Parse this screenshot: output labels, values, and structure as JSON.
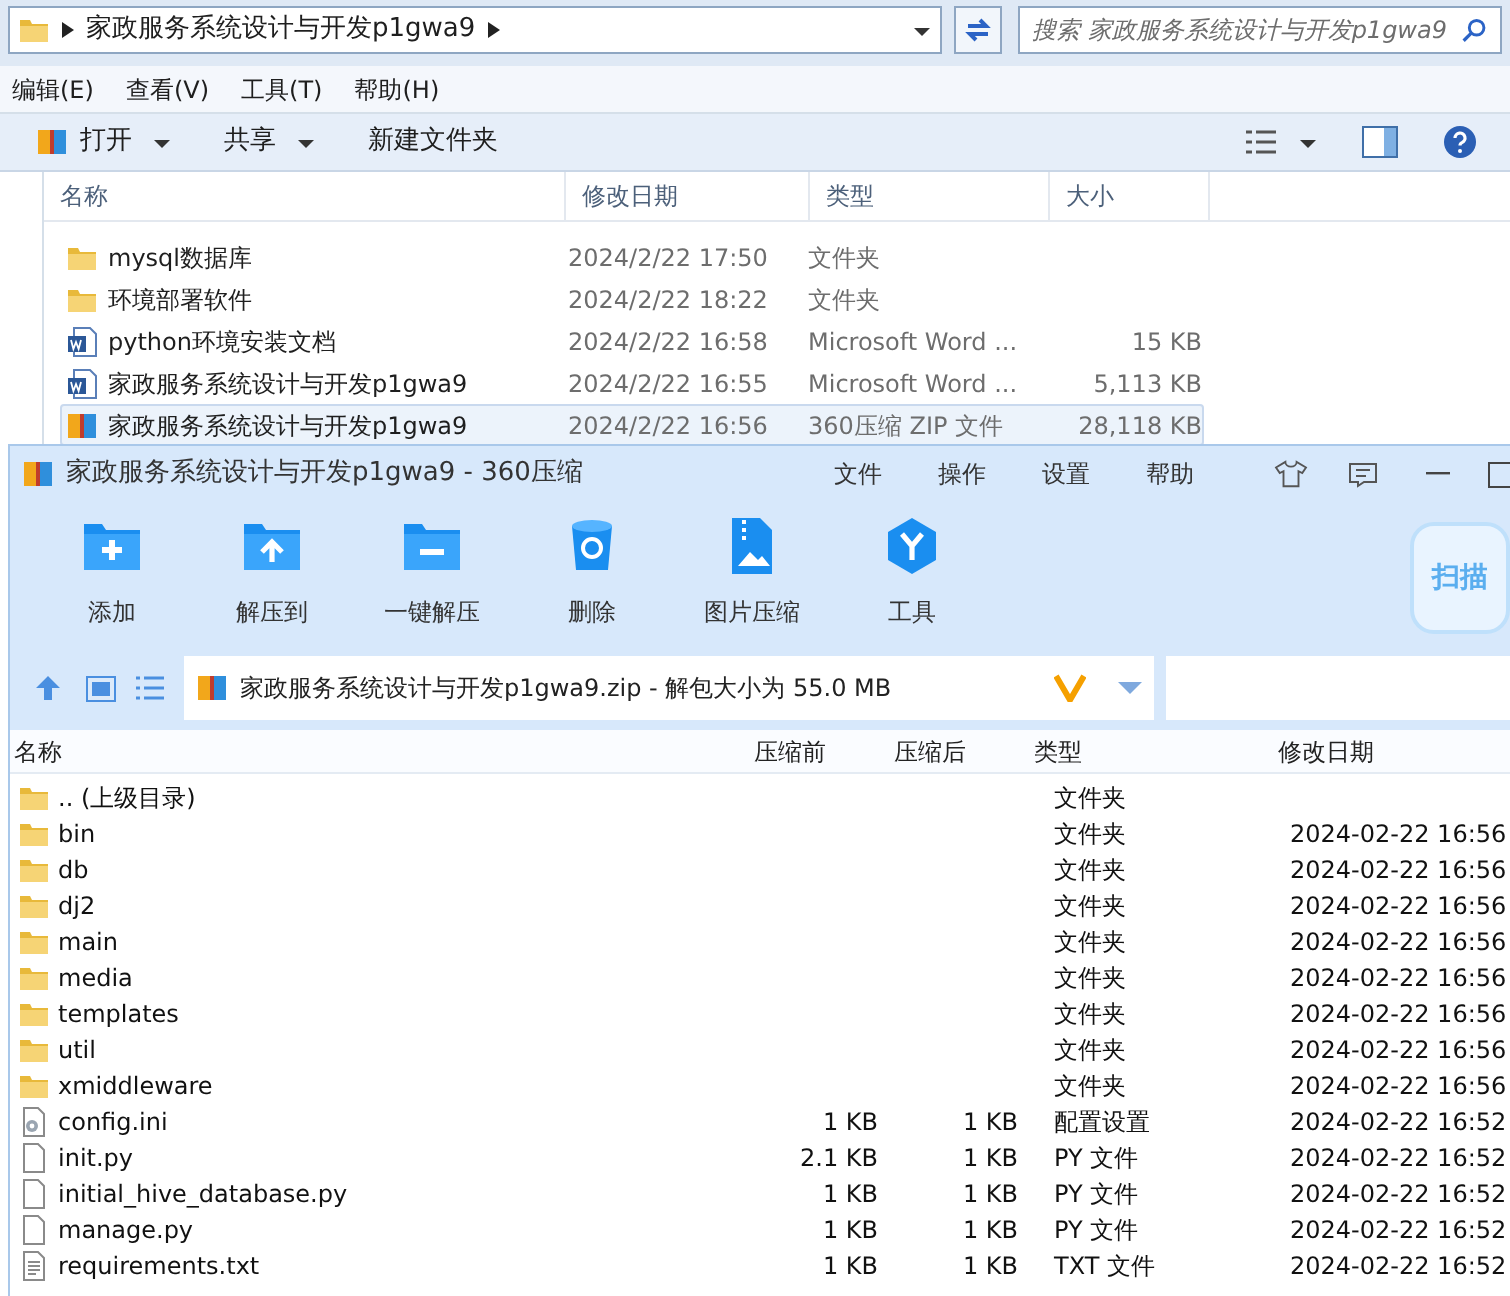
{
  "explorer": {
    "breadcrumb": [
      "家政服务系统设计与开发p1gwa9"
    ],
    "search": {
      "placeholder": "搜索 家政服务系统设计与开发p1gwa9"
    },
    "menu": [
      "编辑(E)",
      "查看(V)",
      "工具(T)",
      "帮助(H)"
    ],
    "toolbar": [
      {
        "label": "打开",
        "kind": "open",
        "dropdown": true
      },
      {
        "label": "共享",
        "kind": "plain",
        "dropdown": true
      },
      {
        "label": "新建文件夹",
        "kind": "plain",
        "dropdown": false
      }
    ],
    "columns": [
      "名称",
      "修改日期",
      "类型",
      "大小"
    ],
    "files": [
      {
        "kind": "folder",
        "name": "mysql数据库",
        "modified": "2024/2/22 17:50",
        "type": "文件夹",
        "selected": false
      },
      {
        "kind": "folder",
        "name": "环境部署软件",
        "modified": "2024/2/22 18:22",
        "type": "文件夹",
        "selected": false
      },
      {
        "kind": "word",
        "name": "python环境安装文档",
        "modified": "2024/2/22 16:58",
        "type": "Microsoft Word ...",
        "size": "15 KB",
        "selected": false
      },
      {
        "kind": "word",
        "name": "家政服务系统设计与开发p1gwa9",
        "modified": "2024/2/22 16:55",
        "type": "Microsoft Word ...",
        "size": "5,113 KB",
        "selected": false
      },
      {
        "kind": "zip",
        "name": "家政服务系统设计与开发p1gwa9",
        "modified": "2024/2/22 16:56",
        "type": "360压缩 ZIP 文件",
        "size": "28,118 KB",
        "selected": true
      }
    ]
  },
  "archiver": {
    "title": "家政服务系统设计与开发p1gwa9 - 360压缩",
    "menu": [
      "文件",
      "操作",
      "设置",
      "帮助"
    ],
    "tools": [
      {
        "kind": "add",
        "label": "添加"
      },
      {
        "kind": "extract",
        "label": "解压到"
      },
      {
        "kind": "oneclick",
        "label": "一键解压"
      },
      {
        "kind": "delete",
        "label": "删除"
      },
      {
        "kind": "image",
        "label": "图片压缩"
      },
      {
        "kind": "tools",
        "label": "工具"
      }
    ],
    "scan": "扫描",
    "path": "家政服务系统设计与开发p1gwa9.zip - 解包大小为 55.0 MB",
    "columns": [
      "名称",
      "压缩前",
      "压缩后",
      "类型",
      "修改日期"
    ],
    "entries": [
      {
        "kind": "folder",
        "name": ".. (上级目录)",
        "type": "文件夹"
      },
      {
        "kind": "folder",
        "name": "bin",
        "type": "文件夹",
        "modified": "2024-02-22 16:56"
      },
      {
        "kind": "folder",
        "name": "db",
        "type": "文件夹",
        "modified": "2024-02-22 16:56"
      },
      {
        "kind": "folder",
        "name": "dj2",
        "type": "文件夹",
        "modified": "2024-02-22 16:56"
      },
      {
        "kind": "folder",
        "name": "main",
        "type": "文件夹",
        "modified": "2024-02-22 16:56"
      },
      {
        "kind": "folder",
        "name": "media",
        "type": "文件夹",
        "modified": "2024-02-22 16:56"
      },
      {
        "kind": "folder",
        "name": "templates",
        "type": "文件夹",
        "modified": "2024-02-22 16:56"
      },
      {
        "kind": "folder",
        "name": "util",
        "type": "文件夹",
        "modified": "2024-02-22 16:56"
      },
      {
        "kind": "folder",
        "name": "xmiddleware",
        "type": "文件夹",
        "modified": "2024-02-22 16:56"
      },
      {
        "kind": "config",
        "name": "config.ini",
        "before": "1 KB",
        "after": "1 KB",
        "type": "配置设置",
        "modified": "2024-02-22 16:52"
      },
      {
        "kind": "file",
        "name": "init.py",
        "before": "2.1 KB",
        "after": "1 KB",
        "type": "PY 文件",
        "modified": "2024-02-22 16:52"
      },
      {
        "kind": "file",
        "name": "initial_hive_database.py",
        "before": "1 KB",
        "after": "1 KB",
        "type": "PY 文件",
        "modified": "2024-02-22 16:52"
      },
      {
        "kind": "file",
        "name": "manage.py",
        "before": "1 KB",
        "after": "1 KB",
        "type": "PY 文件",
        "modified": "2024-02-22 16:52"
      },
      {
        "kind": "text",
        "name": "requirements.txt",
        "before": "1 KB",
        "after": "1 KB",
        "type": "TXT 文件",
        "modified": "2024-02-22 16:52"
      }
    ]
  }
}
